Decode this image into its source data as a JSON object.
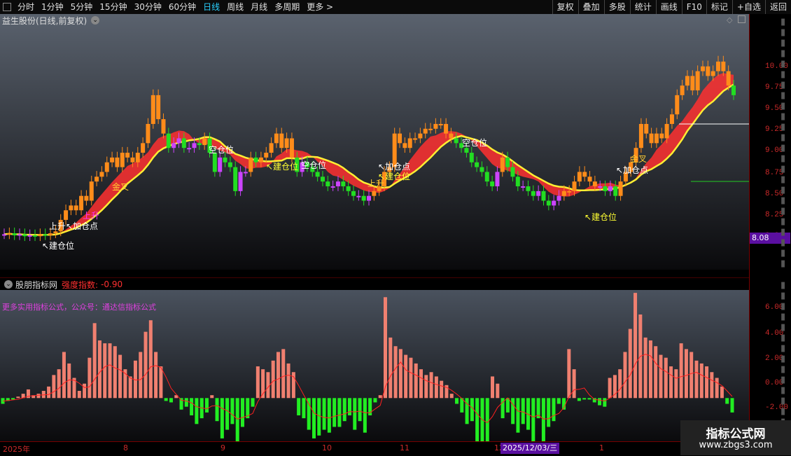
{
  "toolbar": {
    "periods": [
      "分时",
      "1分钟",
      "5分钟",
      "15分钟",
      "30分钟",
      "60分钟",
      "日线",
      "周线",
      "月线",
      "多周期",
      "更多 >"
    ],
    "active_period": "日线",
    "right_buttons": [
      "复权",
      "叠加",
      "多股",
      "统计",
      "画线",
      "F10",
      "标记",
      "+自选",
      "返回"
    ]
  },
  "main": {
    "title": "益生股份(日线,前复权)",
    "price_badge": "8.08",
    "y_ticks": [
      "10.00",
      "9.75",
      "9.50",
      "9.25",
      "9.00",
      "8.75",
      "8.50",
      "8.25",
      "8.00"
    ],
    "labels": [
      {
        "text": "空仓位",
        "color": "#ffffff"
      },
      {
        "text": "↖建仓位",
        "color": "#ffffff"
      },
      {
        "text": "空仓位",
        "color": "#ffffff"
      },
      {
        "text": "↖加仓点",
        "color": "#ffffff"
      },
      {
        "text": "↖建仓位",
        "color": "#ffff33"
      },
      {
        "text": "空仓位",
        "color": "#ffffff"
      },
      {
        "text": "↖加仓点",
        "color": "#ffffff"
      },
      {
        "text": "↖建仓位",
        "color": "#ffff33"
      },
      {
        "text": "上升↖加仓点",
        "color": "#ffffff"
      },
      {
        "text": "↖建仓位",
        "color": "#ffff33"
      },
      {
        "text": "金叉",
        "color": "#ffcc33"
      },
      {
        "text": "金叉",
        "color": "#ffcc33"
      },
      {
        "text": "上升",
        "color": "#ffcc33"
      },
      {
        "text": "上升",
        "color": "#ff33ff"
      }
    ]
  },
  "sub": {
    "name": "股朋指标网",
    "strength_label": "强度指数:",
    "strength_value": "-0.90",
    "promo": "更多实用指标公式，公众号：通达信指标公式",
    "y_ticks": [
      "6.00",
      "4.00",
      "2.00",
      "0.00",
      "-2.00"
    ]
  },
  "x_axis": {
    "labels": [
      "2025年",
      "8",
      "9",
      "10",
      "11",
      "12",
      "1"
    ],
    "date_badge": "2025/12/03/三"
  },
  "watermark": {
    "line1": "指标公式网",
    "line2": "www.zbgs3.com"
  },
  "chart_data": [
    {
      "type": "candlestick",
      "title": "益生股份(日线,前复权)",
      "ylim": [
        7.9,
        10.2
      ],
      "close": [
        8.05,
        8.06,
        8.04,
        8.05,
        8.03,
        8.04,
        8.03,
        8.05,
        8.04,
        8.06,
        8.08,
        8.2,
        8.3,
        8.35,
        8.3,
        8.45,
        8.4,
        8.6,
        8.65,
        8.7,
        8.8,
        8.85,
        8.75,
        8.9,
        8.85,
        8.8,
        8.9,
        9.0,
        9.2,
        9.5,
        9.25,
        9.1,
        8.95,
        9.0,
        9.05,
        8.95,
        8.95,
        9.0,
        8.98,
        9.05,
        8.9,
        8.7,
        8.85,
        8.8,
        8.75,
        8.5,
        8.7,
        8.7,
        8.85,
        8.8,
        8.85,
        8.9,
        9.0,
        9.1,
        8.95,
        9.05,
        8.85,
        8.7,
        8.8,
        8.75,
        8.7,
        8.65,
        8.6,
        8.55,
        8.55,
        8.6,
        8.55,
        8.5,
        8.45,
        8.45,
        8.4,
        8.45,
        8.5,
        8.55,
        8.7,
        8.75,
        9.1,
        9.0,
        8.95,
        9.05,
        9.05,
        9.1,
        9.15,
        9.15,
        9.2,
        9.2,
        9.1,
        9.05,
        9.0,
        8.95,
        8.9,
        8.8,
        8.75,
        8.7,
        8.6,
        8.55,
        8.7,
        8.85,
        8.75,
        8.65,
        8.55,
        8.55,
        8.5,
        8.45,
        8.5,
        8.4,
        8.35,
        8.4,
        8.45,
        8.5,
        8.5,
        8.6,
        8.7,
        8.65,
        8.6,
        8.55,
        8.55,
        8.5,
        8.55,
        8.45,
        8.6,
        8.7,
        8.8,
        8.95,
        9.2,
        9.1,
        9.0,
        9.1,
        9.05,
        9.2,
        9.3,
        9.5,
        9.6,
        9.7,
        9.55,
        9.75,
        9.8,
        9.7,
        9.75,
        9.85,
        9.75,
        9.6,
        9.5
      ]
    },
    {
      "type": "bar",
      "title": "股朋指标网 强度指数",
      "ylim": [
        -3,
        7.5
      ],
      "values": [
        -0.4,
        -0.2,
        -0.1,
        0.1,
        0.3,
        0.6,
        0.2,
        0.3,
        0.5,
        0.8,
        1.6,
        2.0,
        3.2,
        2.4,
        1.4,
        0.5,
        1.0,
        2.8,
        5.2,
        4.0,
        3.8,
        3.8,
        3.6,
        3.0,
        2.0,
        1.5,
        2.6,
        3.2,
        4.6,
        5.4,
        3.2,
        2.2,
        -0.2,
        -0.3,
        0.2,
        -0.8,
        -0.6,
        -1.2,
        -1.8,
        -1.4,
        -1.0,
        0.2,
        -1.6,
        -2.8,
        -2.2,
        -1.8,
        -3.8,
        -2.0,
        -1.4,
        -0.6,
        2.2,
        2.0,
        1.8,
        2.6,
        3.2,
        3.4,
        2.4,
        1.8,
        -1.2,
        -1.4,
        -2.2,
        -2.8,
        -2.6,
        -2.2,
        -2.4,
        -2.0,
        -2.0,
        -1.6,
        -1.2,
        -2.2,
        -1.6,
        -2.4,
        -1.2,
        -0.3,
        0.2,
        7.0,
        4.2,
        3.6,
        3.4,
        3.0,
        2.8,
        2.4,
        2.0,
        1.6,
        1.8,
        1.5,
        1.2,
        0.9,
        0.3,
        -0.4,
        -1.0,
        -1.8,
        -1.6,
        -3.6,
        -4.0,
        -3.2,
        1.5,
        1.0,
        -1.4,
        -1.0,
        -1.8,
        -2.4,
        -1.8,
        -2.2,
        -3.2,
        -1.4,
        -3.8,
        -2.0,
        -1.6,
        -0.4,
        -0.8,
        3.4,
        2.0,
        -0.2,
        -0.1,
        -0.1,
        -0.3,
        -0.5,
        -0.6,
        1.4,
        1.6,
        2.0,
        3.2,
        4.8,
        7.3,
        5.8,
        4.2,
        4.0,
        3.6,
        3.0,
        2.8,
        2.2,
        2.0,
        3.8,
        3.4,
        3.2,
        2.6,
        2.4,
        2.2,
        1.8,
        1.4,
        0.8,
        -0.4,
        -1.0
      ]
    }
  ]
}
